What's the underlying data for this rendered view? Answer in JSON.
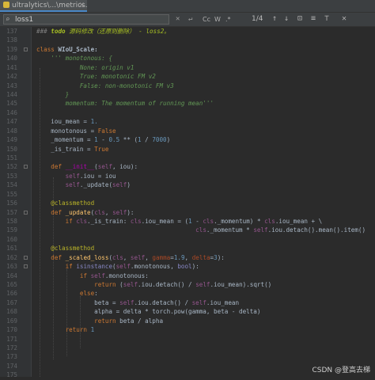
{
  "tab": {
    "title": "ultralytics\\...\\metrics.py",
    "icon": "python-file-icon"
  },
  "search": {
    "query": "loss1",
    "match_case": "Cc",
    "whole_words": "W",
    "regex": ".*",
    "match_count": "1/4"
  },
  "lines": [
    {
      "n": "137"
    },
    {
      "n": "138"
    },
    {
      "n": "139"
    },
    {
      "n": "140"
    },
    {
      "n": "141"
    },
    {
      "n": "142"
    },
    {
      "n": "143"
    },
    {
      "n": "144"
    },
    {
      "n": "145"
    },
    {
      "n": "146"
    },
    {
      "n": "147"
    },
    {
      "n": "148"
    },
    {
      "n": "149"
    },
    {
      "n": "150"
    },
    {
      "n": "151"
    },
    {
      "n": "152"
    },
    {
      "n": "153"
    },
    {
      "n": "154"
    },
    {
      "n": "155"
    },
    {
      "n": "156"
    },
    {
      "n": "157"
    },
    {
      "n": "158"
    },
    {
      "n": "159"
    },
    {
      "n": "160"
    },
    {
      "n": "161"
    },
    {
      "n": "162"
    },
    {
      "n": "163"
    },
    {
      "n": "164"
    },
    {
      "n": "165"
    },
    {
      "n": "166"
    },
    {
      "n": "167"
    },
    {
      "n": "168"
    },
    {
      "n": "169"
    },
    {
      "n": "170"
    },
    {
      "n": "171"
    },
    {
      "n": "172"
    },
    {
      "n": "173"
    },
    {
      "n": "174"
    },
    {
      "n": "175"
    }
  ],
  "code": {
    "l137_a": "### ",
    "l137_b": "todo",
    "l137_c": " 源码修改（还原则删除） - loss2。",
    "l139_kw": "class",
    "l139_name": " WIoU_Scale:",
    "l140": "    ''' monotonous: {",
    "l141": "            None: origin v1",
    "l142": "            True: monotonic FM v2",
    "l143": "            False: non-monotonic FM v3",
    "l144": "        }",
    "l145": "        momentum: The momentum of running mean'''",
    "l147_a": "    iou_mean = ",
    "l147_b": "1.",
    "l148_a": "    monotonous = ",
    "l148_b": "False",
    "l149_a": "    _momentum = ",
    "l149_b": "1",
    "l149_c": " - ",
    "l149_d": "0.5",
    "l149_e": " ** (",
    "l149_f": "1",
    "l149_g": " / ",
    "l149_h": "7000",
    "l149_i": ")",
    "l150_a": "    _is_train = ",
    "l150_b": "True",
    "l152_a": "    ",
    "l152_kw": "def",
    "l152_sp": " ",
    "l152_fn": "__init__",
    "l152_b": "(",
    "l152_self": "self",
    "l152_c": ", iou):",
    "l153_a": "        ",
    "l153_self": "self",
    "l153_b": ".iou = iou",
    "l154_a": "        ",
    "l154_self": "self",
    "l154_b": "._update(",
    "l154_self2": "self",
    "l154_c": ")",
    "l156_a": "    ",
    "l156_deco": "@classmethod",
    "l157_a": "    ",
    "l157_kw": "def",
    "l157_sp": " ",
    "l157_fn": "_update",
    "l157_b": "(",
    "l157_cls": "cls",
    "l157_c": ", ",
    "l157_self": "self",
    "l157_d": "):",
    "l158_a": "        ",
    "l158_kw": "if",
    "l158_b": " ",
    "l158_cls": "cls",
    "l158_c": "._is_train: ",
    "l158_cls2": "cls",
    "l158_d": ".iou_mean = (",
    "l158_e": "1",
    "l158_f": " - ",
    "l158_cls3": "cls",
    "l158_g": "._momentum) * ",
    "l158_cls4": "cls",
    "l158_h": ".iou_mean + \\",
    "l159_a": "                                            ",
    "l159_cls": "cls",
    "l159_b": "._momentum * ",
    "l159_self": "self",
    "l159_c": ".iou.detach().mean().item()",
    "l161_a": "    ",
    "l161_deco": "@classmethod",
    "l162_a": "    ",
    "l162_kw": "def",
    "l162_sp": " ",
    "l162_fn": "_scaled_loss",
    "l162_b": "(",
    "l162_cls": "cls",
    "l162_c": ", ",
    "l162_self": "self",
    "l162_d": ", ",
    "l162_p1": "gamma",
    "l162_e": "=",
    "l162_n1": "1.9",
    "l162_f": ", ",
    "l162_p2": "delta",
    "l162_g": "=",
    "l162_n2": "3",
    "l162_h": "):",
    "l163_a": "        ",
    "l163_kw": "if",
    "l163_b": " ",
    "l163_bi": "isinstance",
    "l163_c": "(",
    "l163_self": "self",
    "l163_d": ".monotonous, ",
    "l163_bi2": "bool",
    "l163_e": "):",
    "l164_a": "            ",
    "l164_kw": "if",
    "l164_b": " ",
    "l164_self": "self",
    "l164_c": ".monotonous:",
    "l165_a": "                ",
    "l165_kw": "return",
    "l165_b": " (",
    "l165_self": "self",
    "l165_c": ".iou.detach() / ",
    "l165_self2": "self",
    "l165_d": ".iou_mean).sqrt()",
    "l166_a": "            ",
    "l166_kw": "else",
    "l166_b": ":",
    "l167_a": "                beta = ",
    "l167_self": "self",
    "l167_b": ".iou.detach() / ",
    "l167_self2": "self",
    "l167_c": ".iou_mean",
    "l168_a": "                alpha = delta * torch.pow(gamma, beta - delta)",
    "l169_a": "                ",
    "l169_kw": "return",
    "l169_b": " beta / alpha",
    "l170_a": "        ",
    "l170_kw": "return",
    "l170_b": " ",
    "l170_n": "1"
  },
  "watermark": "CSDN @登高去梯"
}
